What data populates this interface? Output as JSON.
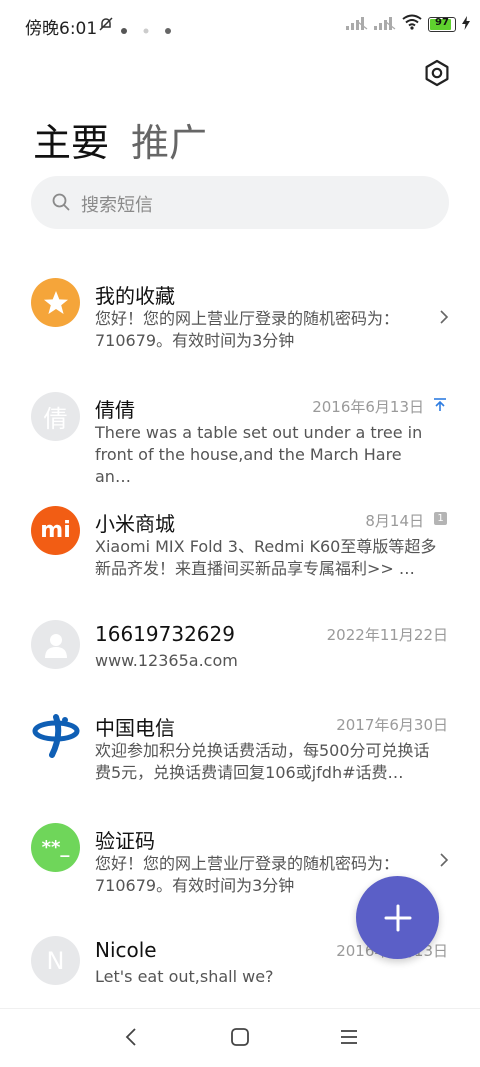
{
  "status": {
    "time": "傍晚6:01",
    "battery": "97"
  },
  "tabs": {
    "main": "主要",
    "promo": "推广"
  },
  "search": {
    "placeholder": "搜索短信"
  },
  "conversations": [
    {
      "name": "我的收藏",
      "date": "",
      "preview": "您好！您的网上营业厅登录的随机密码为：710679。有效时间为3分钟",
      "avatar_text": "★",
      "avatar_color": "#f5a53a"
    },
    {
      "name": "倩倩",
      "date": "2016年6月13日",
      "preview": "There was a table set out under a tree in front of the house,and the March Hare an…",
      "avatar_text": "倩",
      "avatar_color": "#e7e8ea"
    },
    {
      "name": "小米商城",
      "date": "8月14日",
      "preview": "Xiaomi MIX Fold 3、Redmi K60至尊版等超多新品齐发！来直播间买新品享专属福利>> …",
      "avatar_text": "mi",
      "avatar_color": "#f25d14",
      "badge": "1"
    },
    {
      "name": "16619732629",
      "date": "2022年11月22日",
      "preview": "www.12365a.com",
      "avatar_text": "",
      "avatar_color": "#e7e8ea"
    },
    {
      "name": "中国电信",
      "date": "2017年6月30日",
      "preview": "欢迎参加积分兑换话费活动，每500分可兑换话费5元，兑换话费请回复106或jfdh#话费…",
      "avatar_text": "",
      "avatar_color": "#ffffff"
    },
    {
      "name": "验证码",
      "date": "",
      "preview": "您好！您的网上营业厅登录的随机密码为：710679。有效时间为3分钟",
      "avatar_text": "**_",
      "avatar_color": "#6fd65a"
    },
    {
      "name": "Nicole",
      "date": "2016年6月13日",
      "preview": "Let's eat out,shall we?",
      "avatar_text": "N",
      "avatar_color": "#e7e8ea"
    }
  ],
  "colors": {
    "fab": "#5b5fc7",
    "accent_blue": "#2f7de1"
  },
  "icons": {
    "settings": "settings-hexagon-icon",
    "search": "search-icon",
    "chevron": "chevron-right-icon",
    "pin": "pin-top-icon",
    "fab": "plus-icon",
    "nav_back": "back-icon",
    "nav_home": "home-icon",
    "nav_menu": "menu-icon"
  }
}
